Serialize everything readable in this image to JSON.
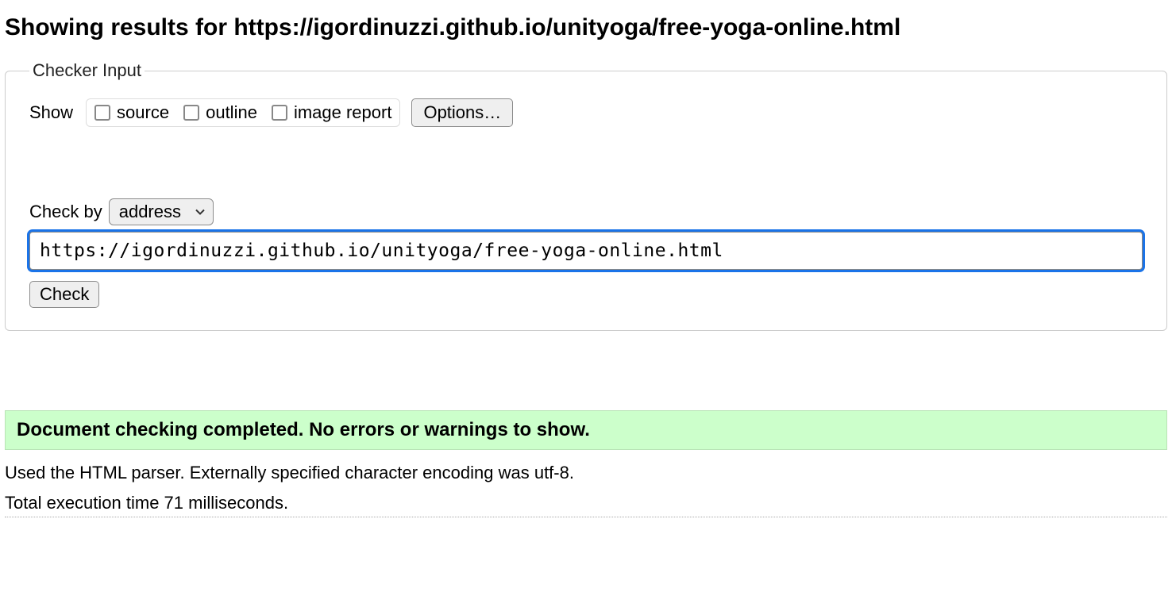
{
  "heading": "Showing results for https://igordinuzzi.github.io/unityoga/free-yoga-online.html",
  "fieldset": {
    "legend": "Checker Input",
    "show_label": "Show",
    "checkboxes": {
      "source": "source",
      "outline": "outline",
      "image_report": "image report"
    },
    "options_button": "Options…",
    "checkby_label": "Check by",
    "checkby_selected": "address",
    "url_value": "https://igordinuzzi.github.io/unityoga/free-yoga-online.html",
    "check_button": "Check"
  },
  "success_message": "Document checking completed. No errors or warnings to show.",
  "parser_info": "Used the HTML parser. Externally specified character encoding was utf-8.",
  "exec_info": "Total execution time 71 milliseconds."
}
